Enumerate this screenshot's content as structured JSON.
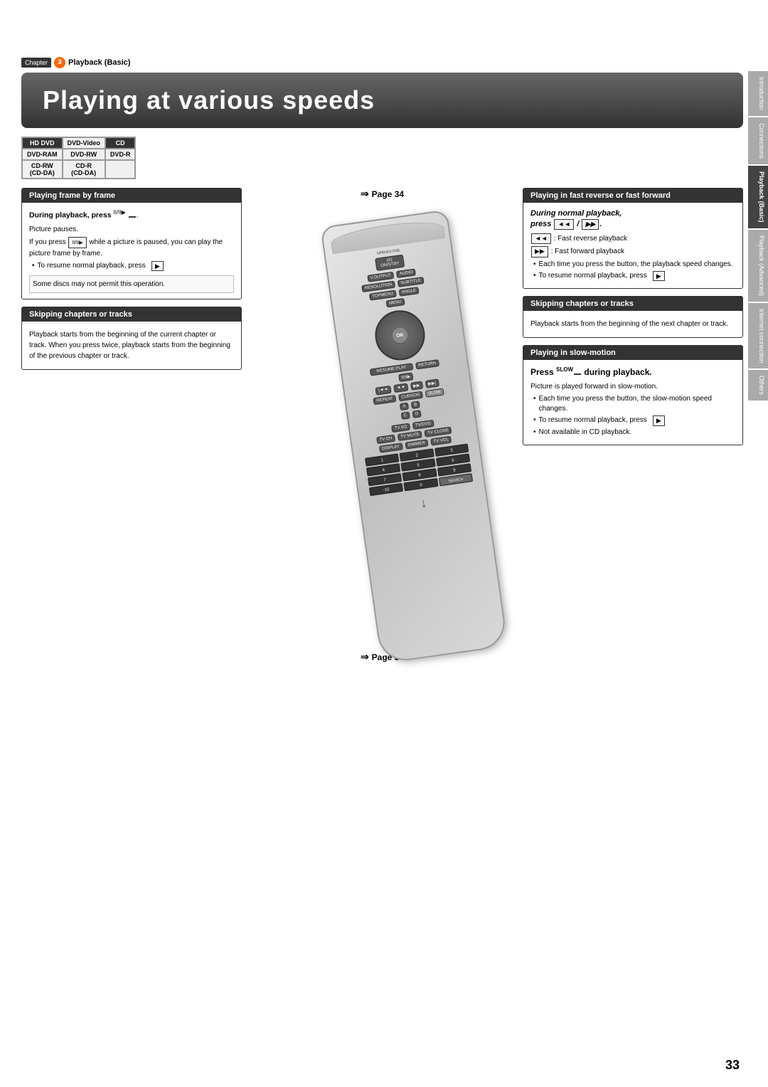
{
  "chapter": {
    "label": "Chapter",
    "number": "3",
    "title": "Playback (Basic)"
  },
  "main_title": "Playing at various speeds",
  "disc_formats": [
    [
      "HD DVD",
      "DVD-Video",
      "CD"
    ],
    [
      "DVD-RAM",
      "DVD-RW",
      "DVD-R"
    ],
    [
      "CD-RW (CD-DA)",
      "CD-R (CD-DA)",
      ""
    ]
  ],
  "sections": {
    "playing_frame_by_frame": {
      "title": "Playing frame by frame",
      "page_ref": "Page 34",
      "instruction": "During playback, press",
      "button_label": "II/II▶",
      "body_lines": [
        "Picture pauses.",
        "If you press while a picture is paused, you can play the picture frame by frame.",
        "• To resume normal playback, press",
        "Some discs may not permit this operation."
      ]
    },
    "skipping_left": {
      "title": "Skipping chapters or tracks",
      "body": "Playback starts from the beginning of the current chapter or track. When you press twice, playback starts from the beginning of the previous chapter or track."
    },
    "fast_reverse_forward": {
      "title": "Playing in fast reverse or fast forward",
      "instruction": "During normal playback, press",
      "button1": "◄◄",
      "button2": "▶▶",
      "lines": [
        "◄◄ : Fast reverse playback",
        "▶▶ : Fast forward playback",
        "• Each time you press the button, the playback speed changes.",
        "• To resume normal playback, press"
      ]
    },
    "skipping_right": {
      "title": "Skipping chapters or tracks",
      "body": "Playback starts from the beginning of the next chapter or track."
    },
    "slow_motion": {
      "title": "Playing in slow-motion",
      "instruction": "Press",
      "button_label": "SLOW",
      "instruction2": "during playback.",
      "lines": [
        "Picture is played forward in slow-motion.",
        "• Each time you press the button, the slow-motion speed changes.",
        "• To resume normal playback, press",
        "• Not available in CD playback."
      ]
    }
  },
  "page_number": "33",
  "sidebar_tabs": [
    {
      "label": "Introduction",
      "active": false
    },
    {
      "label": "Connections",
      "active": false
    },
    {
      "label": "Playback (Basic)",
      "active": true
    },
    {
      "label": "Playback (Advanced)",
      "active": false
    },
    {
      "label": "Internet connection",
      "active": false
    },
    {
      "label": "Others",
      "active": false
    }
  ]
}
